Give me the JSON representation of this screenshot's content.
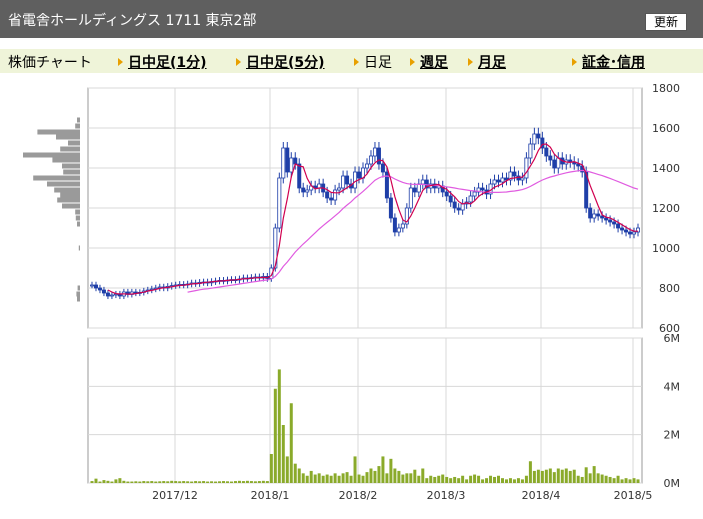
{
  "header": {
    "title": "省電舎ホールディングス 1711 東京2部",
    "update_label": "更新"
  },
  "nav": [
    {
      "label": "株価チャート",
      "link": false,
      "arrow": false
    },
    {
      "label": "日中足(1分)",
      "link": true,
      "arrow": true
    },
    {
      "label": "日中足(5分)",
      "link": true,
      "arrow": true
    },
    {
      "label": "日足",
      "link": false,
      "arrow": true
    },
    {
      "label": "週足",
      "link": true,
      "arrow": true
    },
    {
      "label": "月足",
      "link": true,
      "arrow": true
    },
    {
      "label": "証金･信用",
      "link": true,
      "arrow": true
    }
  ],
  "colors": {
    "candle": "#1f3fa8",
    "ma_short": "#d1004f",
    "ma_long": "#e05be0",
    "volume": "#8aaa2a",
    "profile": "#9a9a9a",
    "nav_bg": "#eff4d9",
    "arrow": "#e8a000"
  },
  "chart_data": [
    {
      "type": "candlestick",
      "y_ticks": [
        "1800",
        "1600",
        "1400",
        "1200",
        "1000",
        "800",
        "600"
      ],
      "ylim": [
        600,
        1800
      ],
      "x_ticks": [
        "2017/12",
        "2018/1",
        "2018/2",
        "2018/3",
        "2018/4",
        "2018/5"
      ],
      "series": [
        {
          "name": "",
          "role": "close",
          "values": [
            815,
            800,
            790,
            775,
            760,
            765,
            770,
            760,
            780,
            768,
            780,
            775,
            778,
            785,
            790,
            795,
            800,
            805,
            800,
            808,
            812,
            815,
            818,
            815,
            820,
            825,
            822,
            828,
            830,
            826,
            832,
            835,
            838,
            835,
            840,
            842,
            840,
            845,
            850,
            848,
            852,
            855,
            850,
            858,
            848,
            900,
            1100,
            1350,
            1500,
            1380,
            1450,
            1420,
            1300,
            1280,
            1290,
            1310,
            1300,
            1320,
            1280,
            1250,
            1240,
            1290,
            1300,
            1360,
            1320,
            1300,
            1380,
            1350,
            1400,
            1420,
            1460,
            1500,
            1420,
            1380,
            1250,
            1150,
            1080,
            1100,
            1120,
            1200,
            1300,
            1280,
            1320,
            1340,
            1300,
            1320,
            1300,
            1310,
            1280,
            1260,
            1230,
            1200,
            1190,
            1220,
            1230,
            1260,
            1280,
            1300,
            1290,
            1270,
            1320,
            1340,
            1330,
            1350,
            1340,
            1380,
            1360,
            1340,
            1350,
            1450,
            1520,
            1570,
            1550,
            1500,
            1460,
            1440,
            1400,
            1450,
            1420,
            1440,
            1430,
            1420,
            1410,
            1380,
            1200,
            1150,
            1170,
            1160,
            1150,
            1140,
            1130,
            1120,
            1100,
            1090,
            1080,
            1070,
            1080,
            1100
          ]
        },
        {
          "name": "",
          "role": "ma_short",
          "values": [
            null,
            null,
            null,
            null,
            790,
            780,
            772,
            770,
            771,
            769,
            770,
            772,
            776,
            779,
            785,
            788,
            793,
            798,
            801,
            803,
            806,
            810,
            813,
            814,
            817,
            820,
            822,
            823,
            827,
            829,
            831,
            833,
            835,
            836,
            838,
            840,
            841,
            843,
            846,
            847,
            849,
            851,
            852,
            853,
            852,
            862,
            911,
            1011,
            1149,
            1246,
            1356,
            1420,
            1410,
            1406,
            1348,
            1312,
            1296,
            1300,
            1300,
            1292,
            1278,
            1276,
            1276,
            1288,
            1302,
            1314,
            1332,
            1342,
            1350,
            1370,
            1402,
            1426,
            1440,
            1436,
            1406,
            1340,
            1256,
            1192,
            1140,
            1130,
            1160,
            1200,
            1244,
            1288,
            1308,
            1312,
            1316,
            1318,
            1302,
            1294,
            1274,
            1256,
            1232,
            1220,
            1226,
            1220,
            1236,
            1258,
            1272,
            1280,
            1288,
            1304,
            1312,
            1322,
            1336,
            1348,
            1350,
            1354,
            1354,
            1378,
            1410,
            1444,
            1488,
            1518,
            1520,
            1504,
            1470,
            1450,
            1436,
            1430,
            1428,
            1432,
            1424,
            1416,
            1372,
            1312,
            1262,
            1212,
            1166,
            1154,
            1150,
            1140,
            1128,
            1116,
            1104,
            1092,
            1084,
            1084
          ]
        },
        {
          "name": "",
          "role": "ma_long",
          "values": [
            null,
            null,
            null,
            null,
            null,
            null,
            null,
            null,
            null,
            null,
            null,
            null,
            null,
            null,
            null,
            null,
            null,
            null,
            null,
            null,
            null,
            null,
            null,
            null,
            779,
            783,
            787,
            791,
            794,
            796,
            799,
            802,
            805,
            808,
            811,
            814,
            817,
            820,
            823,
            826,
            829,
            832,
            835,
            838,
            840,
            845,
            858,
            880,
            908,
            930,
            955,
            980,
            1000,
            1020,
            1038,
            1057,
            1076,
            1095,
            1112,
            1128,
            1144,
            1161,
            1178,
            1198,
            1215,
            1231,
            1250,
            1266,
            1283,
            1301,
            1320,
            1339,
            1350,
            1358,
            1360,
            1356,
            1345,
            1336,
            1328,
            1322,
            1319,
            1318,
            1318,
            1318,
            1316,
            1315,
            1313,
            1311,
            1308,
            1306,
            1303,
            1300,
            1296,
            1293,
            1290,
            1287,
            1285,
            1283,
            1281,
            1279,
            1278,
            1278,
            1278,
            1279,
            1280,
            1283,
            1285,
            1288,
            1292,
            1299,
            1308,
            1319,
            1330,
            1340,
            1348,
            1355,
            1360,
            1366,
            1371,
            1376,
            1380,
            1383,
            1386,
            1388,
            1385,
            1380,
            1374,
            1368,
            1362,
            1355,
            1348,
            1340,
            1332,
            1324,
            1316,
            1308,
            1300,
            1294
          ]
        }
      ],
      "price_profile": [
        {
          "price": 1640,
          "level": 0.05
        },
        {
          "price": 1610,
          "level": 0.08
        },
        {
          "price": 1580,
          "level": 0.71
        },
        {
          "price": 1555,
          "level": 0.4
        },
        {
          "price": 1525,
          "level": 0.2
        },
        {
          "price": 1495,
          "level": 0.33
        },
        {
          "price": 1465,
          "level": 0.95
        },
        {
          "price": 1440,
          "level": 0.46
        },
        {
          "price": 1410,
          "level": 0.3
        },
        {
          "price": 1380,
          "level": 0.28
        },
        {
          "price": 1350,
          "level": 0.78
        },
        {
          "price": 1320,
          "level": 0.55
        },
        {
          "price": 1290,
          "level": 0.43
        },
        {
          "price": 1265,
          "level": 0.33
        },
        {
          "price": 1240,
          "level": 0.38
        },
        {
          "price": 1210,
          "level": 0.3
        },
        {
          "price": 1180,
          "level": 0.08
        },
        {
          "price": 1150,
          "level": 0.07
        },
        {
          "price": 1120,
          "level": 0.05
        },
        {
          "price": 1000,
          "level": 0.02
        },
        {
          "price": 800,
          "level": 0.04
        },
        {
          "price": 770,
          "level": 0.06
        },
        {
          "price": 745,
          "level": 0.05
        }
      ]
    },
    {
      "type": "bar",
      "y_ticks": [
        "6M",
        "4M",
        "2M",
        "0M"
      ],
      "ylim": [
        0,
        6000000
      ],
      "x_ticks": [
        "2017/12",
        "2018/1",
        "2018/2",
        "2018/3",
        "2018/4",
        "2018/5"
      ],
      "series": [
        {
          "name": "",
          "values": [
            80000,
            180000,
            60000,
            120000,
            90000,
            60000,
            150000,
            200000,
            90000,
            60000,
            60000,
            70000,
            60000,
            80000,
            70000,
            80000,
            60000,
            70000,
            80000,
            70000,
            90000,
            80000,
            70000,
            80000,
            70000,
            60000,
            80000,
            70000,
            80000,
            60000,
            70000,
            60000,
            70000,
            80000,
            70000,
            60000,
            80000,
            90000,
            80000,
            90000,
            80000,
            70000,
            80000,
            90000,
            80000,
            1200000,
            3900000,
            4700000,
            2400000,
            1100000,
            3300000,
            800000,
            600000,
            400000,
            300000,
            500000,
            350000,
            400000,
            300000,
            350000,
            300000,
            400000,
            300000,
            400000,
            450000,
            300000,
            1100000,
            350000,
            300000,
            450000,
            600000,
            500000,
            700000,
            1100000,
            400000,
            1000000,
            600000,
            500000,
            350000,
            400000,
            400000,
            550000,
            300000,
            600000,
            200000,
            300000,
            250000,
            300000,
            350000,
            250000,
            200000,
            250000,
            200000,
            300000,
            150000,
            300000,
            350000,
            300000,
            150000,
            200000,
            300000,
            250000,
            300000,
            200000,
            150000,
            200000,
            150000,
            200000,
            150000,
            300000,
            900000,
            500000,
            550000,
            500000,
            550000,
            600000,
            450000,
            600000,
            550000,
            600000,
            500000,
            550000,
            300000,
            250000,
            650000,
            400000,
            700000,
            400000,
            350000,
            300000,
            250000,
            200000,
            300000,
            150000,
            200000,
            150000,
            200000,
            150000
          ]
        }
      ]
    }
  ]
}
